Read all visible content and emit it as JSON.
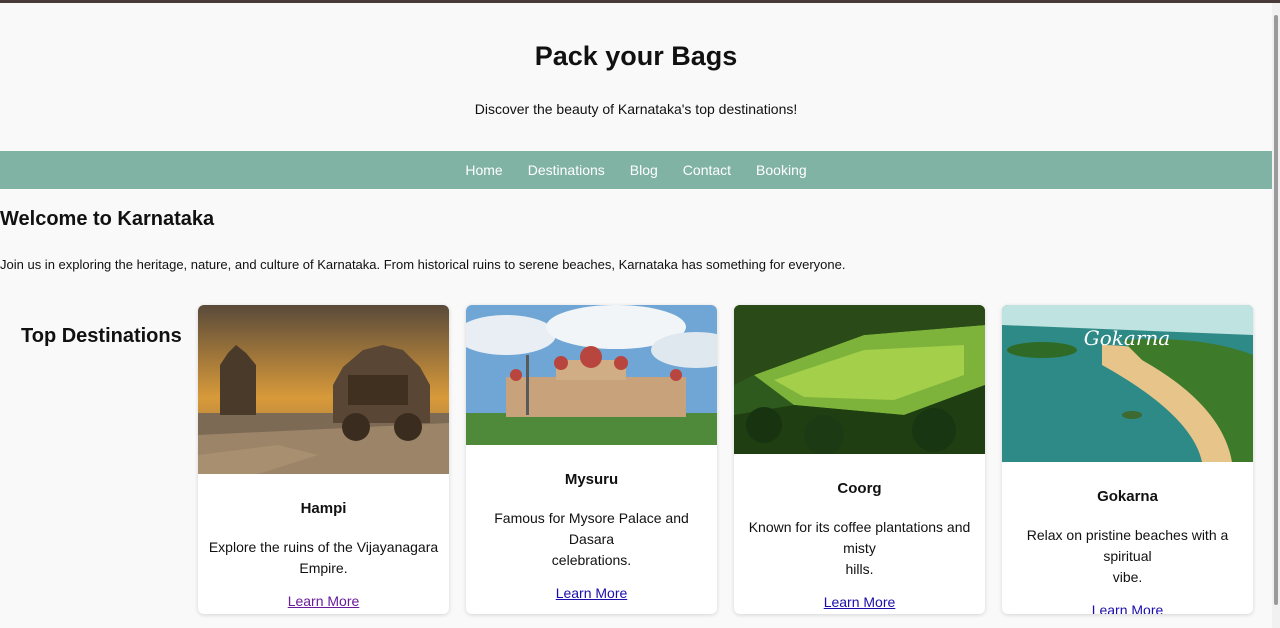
{
  "header": {
    "title": "Pack your Bags",
    "subtitle": "Discover the beauty of Karnataka's top destinations!"
  },
  "nav": {
    "items": [
      "Home",
      "Destinations",
      "Blog",
      "Contact",
      "Booking"
    ],
    "background": "#80b3a3"
  },
  "intro": {
    "heading": "Welcome to Karnataka",
    "text": "Join us in exploring the heritage, nature, and culture of Karnataka. From historical ruins to serene beaches, Karnataka has something for everyone."
  },
  "destinations": {
    "heading": "Top Destinations",
    "cards": [
      {
        "name": "Hampi",
        "desc_line1": "Explore the ruins of the Vijayanagara",
        "desc_line2": "Empire.",
        "link": "Learn More",
        "image": "hampi-stone-chariot-photo"
      },
      {
        "name": "Mysuru",
        "desc_line1": "Famous for Mysore Palace and Dasara",
        "desc_line2": "celebrations.",
        "link": "Learn More",
        "image": "mysore-palace-photo"
      },
      {
        "name": "Coorg",
        "desc_line1": "Known for its coffee plantations and misty",
        "desc_line2": "hills.",
        "link": "Learn More",
        "image": "coorg-plantations-photo"
      },
      {
        "name": "Gokarna",
        "desc_line1": "Relax on pristine beaches with a spiritual",
        "desc_line2": "vibe.",
        "link": "Learn More",
        "image": "gokarna-beach-photo",
        "image_caption": "Gokarna"
      }
    ]
  }
}
